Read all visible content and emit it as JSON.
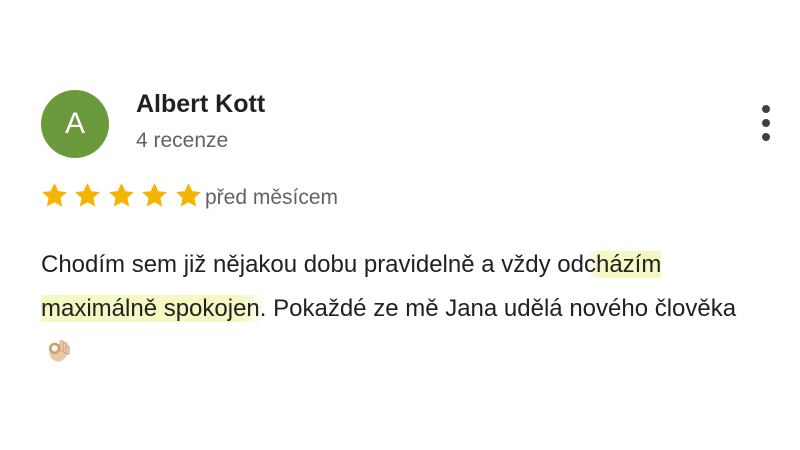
{
  "reviewer": {
    "avatar_letter": "A",
    "avatar_color": "#6a9a3b",
    "name": "Albert Kott",
    "review_count": "4 recenze"
  },
  "menu": {
    "icon": "more-vert-icon"
  },
  "rating": {
    "stars": 5,
    "max_stars": 5,
    "star_color": "#f4b400",
    "time_ago": "před měsícem"
  },
  "review": {
    "text_part1": "Chodím sem již nějakou dobu pravidelně a vždy od",
    "text_highlight": "cházím maximálně spokojen.",
    "text_part2": " Pokaždé ze mě Jana udělá nového člověka",
    "emoji": "ok-hand-emoji"
  }
}
